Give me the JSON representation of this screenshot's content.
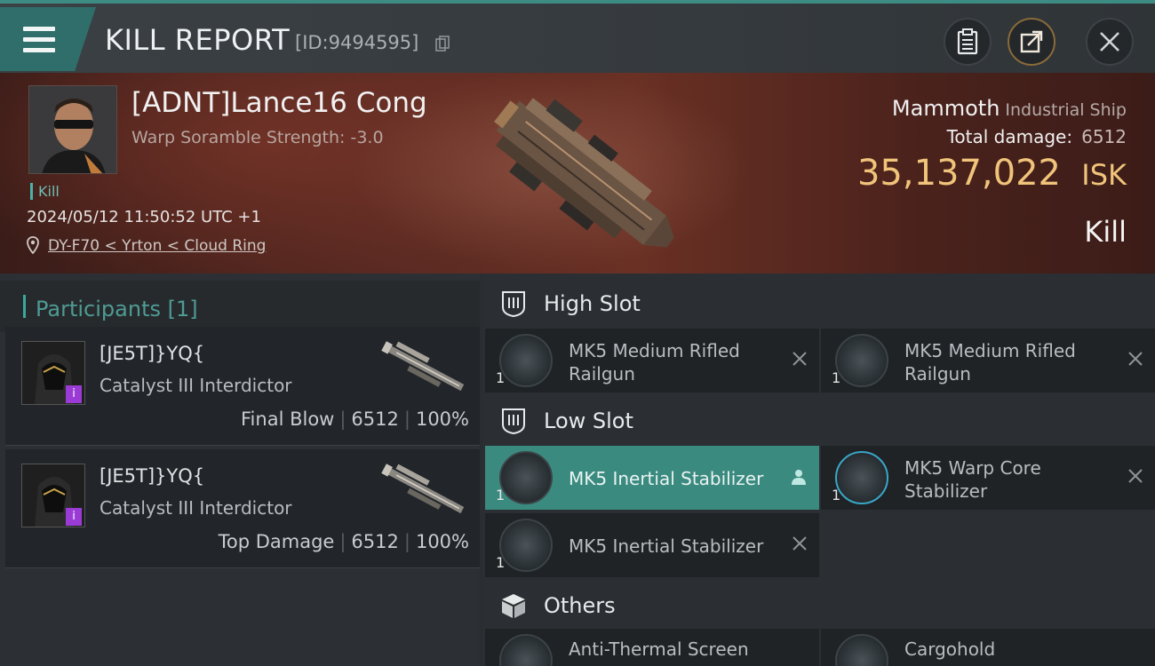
{
  "header": {
    "title": "KILL REPORT",
    "id_text": "[ID:9494595]"
  },
  "hero": {
    "pilot_name": "[ADNT]Lance16 Cong",
    "warp_scramble": "Warp Soramble Strength: -3.0",
    "kill_tag": "Kill",
    "timestamp": "2024/05/12 11:50:52 UTC +1",
    "location": "DY-F70 < Yrton < Cloud Ring",
    "ship_name": "Mammoth",
    "ship_class": "Industrial Ship",
    "total_damage_label": "Total damage:",
    "total_damage_value": "6512",
    "isk_value": "35,137,022",
    "isk_unit": "ISK",
    "result": "Kill"
  },
  "participants": {
    "title": "Participants",
    "count": "[1]",
    "items": [
      {
        "name": "[JE5T]}YQ{",
        "ship": "Catalyst III Interdictor",
        "role": "Final Blow",
        "damage": "6512",
        "percent": "100%"
      },
      {
        "name": "[JE5T]}YQ{",
        "ship": "Catalyst III Interdictor",
        "role": "Top Damage",
        "damage": "6512",
        "percent": "100%"
      }
    ]
  },
  "slots": {
    "high": {
      "title": "High Slot",
      "items": [
        {
          "qty": "1",
          "name": "MK5 Medium Rifled Railgun"
        },
        {
          "qty": "1",
          "name": "MK5 Medium Rifled Railgun"
        }
      ]
    },
    "low": {
      "title": "Low Slot",
      "items": [
        {
          "qty": "1",
          "name": "MK5 Inertial Stabilizer"
        },
        {
          "qty": "1",
          "name": "MK5 Warp Core Stabilizer"
        },
        {
          "qty": "1",
          "name": "MK5 Inertial Stabilizer"
        }
      ]
    },
    "others": {
      "title": "Others",
      "items": [
        {
          "qty": "",
          "name": "Anti-Thermal Screen"
        },
        {
          "qty": "",
          "name": "Cargohold"
        }
      ]
    }
  },
  "colors": {
    "accent": "#3ca89d",
    "isk": "#f0c47a",
    "active_module": "#3b8a80"
  },
  "icons": [
    "menu-icon",
    "copy-icon",
    "clipboard-icon",
    "share-icon",
    "close-icon",
    "location-pin-icon",
    "slot-shield-icon",
    "cube-icon",
    "remove-x-icon",
    "user-icon"
  ]
}
